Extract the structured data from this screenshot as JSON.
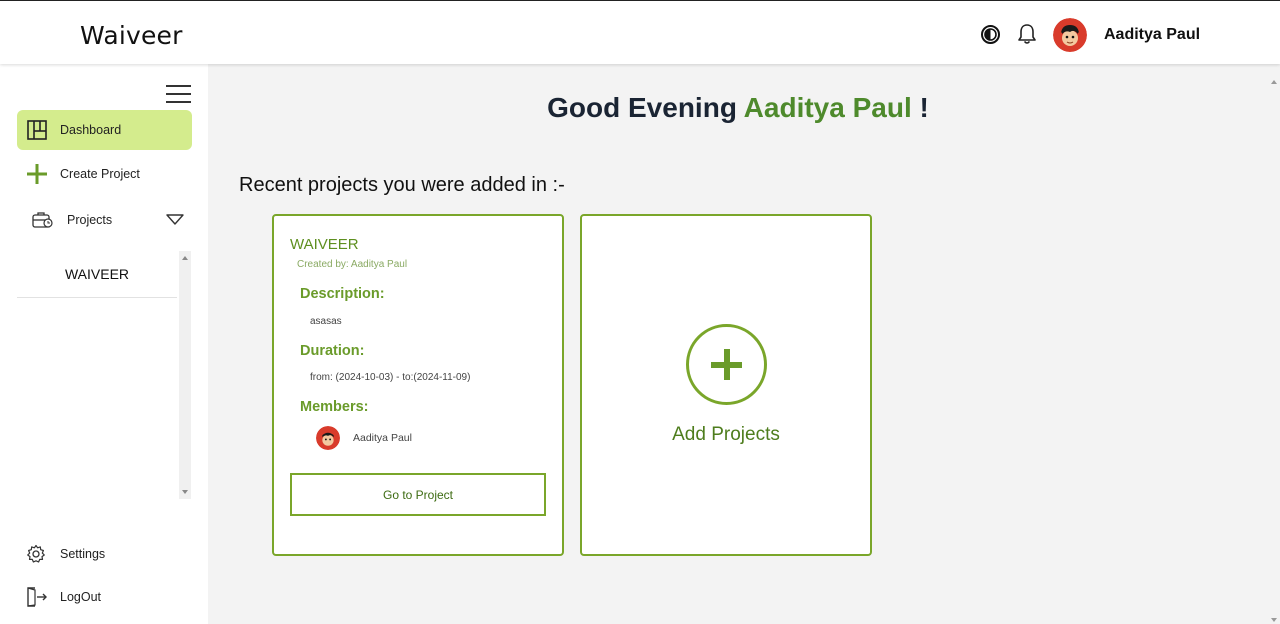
{
  "header": {
    "brand": "Waiveer",
    "user_name": "Aaditya Paul",
    "icons": [
      "theme-toggle-icon",
      "bell-icon",
      "avatar"
    ]
  },
  "sidebar": {
    "items": [
      {
        "label": "Dashboard",
        "icon": "dashboard-icon",
        "active": true
      },
      {
        "label": "Create Project",
        "icon": "plus-icon"
      },
      {
        "label": "Projects",
        "icon": "projects-icon"
      }
    ],
    "project_list": [
      "WAIVEER"
    ],
    "bottom_items": [
      {
        "label": "Settings",
        "icon": "gear-icon"
      },
      {
        "label": "LogOut",
        "icon": "logout-icon"
      }
    ]
  },
  "main": {
    "greeting_prefix": "Good Evening",
    "greeting_name": "Aaditya Paul",
    "greeting_suffix": "!",
    "section_title": "Recent projects you were added in :-",
    "project_card": {
      "title": "WAIVEER",
      "created_by": "Created by: Aaditya Paul",
      "description_label": "Description:",
      "description": "asasas",
      "duration_label": "Duration:",
      "duration": "from: (2024-10-03) - to:(2024-11-09)",
      "members_label": "Members:",
      "members": [
        "Aaditya Paul"
      ],
      "button": "Go to Project"
    },
    "add_card": {
      "label": "Add Projects"
    }
  },
  "colors": {
    "accent": "#7aa62a",
    "active_nav": "#d4ec8d",
    "greeting_name": "#4e8a2c"
  }
}
